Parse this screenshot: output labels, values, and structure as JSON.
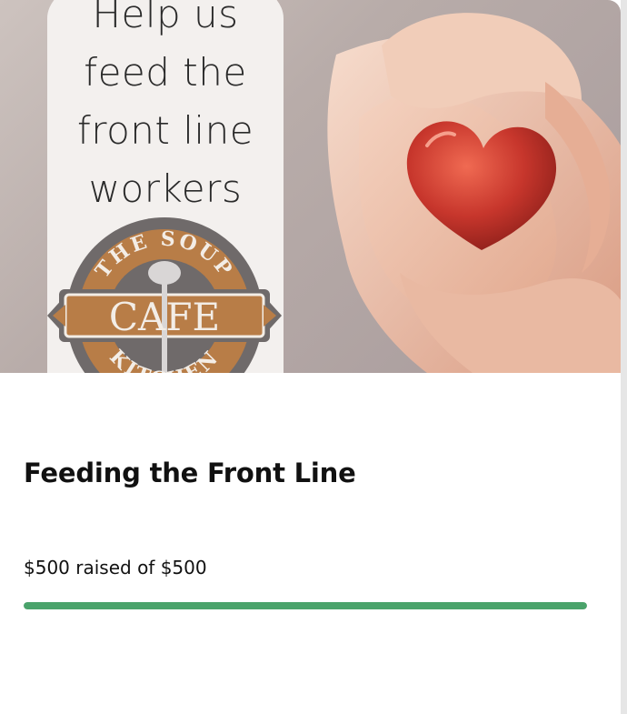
{
  "campaign": {
    "title": "Feeding the Front Line",
    "raised_text": "$500 raised of $500",
    "raised_amount": 500,
    "goal_amount": 500,
    "progress_fraction": 1.0
  },
  "hero_image": {
    "slogan_lines": [
      "Help us",
      "feed the",
      "front line",
      "workers"
    ],
    "logo": {
      "top_text": "THE SOUP",
      "center_text": "CAFE",
      "bottom_text": "KITCHEN"
    }
  },
  "colors": {
    "progress": "#4aa36b",
    "logo_bronze": "#b87d47",
    "logo_ring": "#6f6a6a",
    "heart": "#c7362c"
  }
}
